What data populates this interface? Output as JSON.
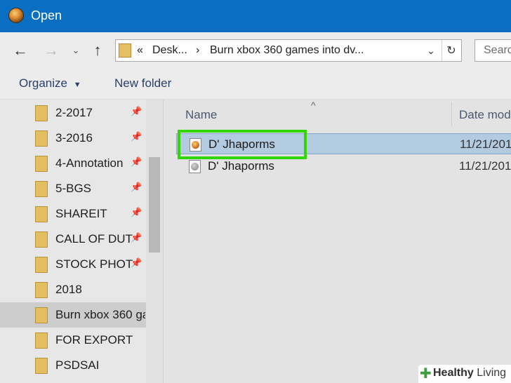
{
  "window": {
    "title": "Open"
  },
  "nav": {
    "back_icon": "arrow-left-icon",
    "forward_icon": "arrow-right-icon",
    "recent_icon": "chevron-down-icon",
    "up_icon": "arrow-up-icon"
  },
  "address": {
    "overflow": "«",
    "crumbs": [
      "Desk...",
      "Burn xbox 360 games into dv..."
    ],
    "separator": "›"
  },
  "search": {
    "placeholder": "Search"
  },
  "toolbar": {
    "organize_label": "Organize",
    "new_folder_label": "New folder"
  },
  "sidebar": {
    "items": [
      {
        "label": "2-2017",
        "pinned": true
      },
      {
        "label": "3-2016",
        "pinned": true
      },
      {
        "label": "4-Annotation",
        "pinned": true
      },
      {
        "label": "5-BGS",
        "pinned": true
      },
      {
        "label": "SHAREIT",
        "pinned": true
      },
      {
        "label": "CALL OF DUT",
        "pinned": true
      },
      {
        "label": "STOCK PHOT",
        "pinned": true
      },
      {
        "label": "2018",
        "pinned": false
      },
      {
        "label": "Burn xbox 360 ga",
        "pinned": false,
        "selected": true
      },
      {
        "label": "FOR EXPORT",
        "pinned": false
      },
      {
        "label": "PSDSAI",
        "pinned": false
      }
    ]
  },
  "columns": {
    "name": "Name",
    "date": "Date mod"
  },
  "files": [
    {
      "name": "D' Jhaporms",
      "date": "11/21/201",
      "selected": true
    },
    {
      "name": "D' Jhaporms",
      "date": "11/21/201",
      "selected": false
    }
  ],
  "watermark": {
    "brand_bold": "Healthy",
    "brand_rest": " Living"
  },
  "colors": {
    "titlebar": "#0a6fc2",
    "highlight": "#32d600",
    "selection": "#b3cbe0",
    "folder": "#e3bf63"
  }
}
